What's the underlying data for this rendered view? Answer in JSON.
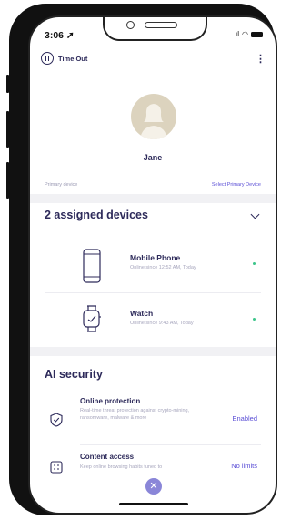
{
  "status_bar": {
    "time": "3:06"
  },
  "header": {
    "timeout_label": "Time Out",
    "more_icon": "more-vertical-icon"
  },
  "profile": {
    "name": "Jane",
    "primary_label": "Primary device",
    "select_primary_label": "Select Primary Device"
  },
  "devices_section": {
    "title": "2 assigned devices",
    "devices": [
      {
        "name": "Mobile Phone",
        "status": "Online since 12:52 AM, Today",
        "icon": "mobile-phone-icon"
      },
      {
        "name": "Watch",
        "status": "Online since 9:43 AM, Today",
        "icon": "watch-icon"
      }
    ]
  },
  "ai_security": {
    "title": "AI security",
    "features": [
      {
        "title": "Online protection",
        "description": "Real-time threat protection against crypto-mining, ransomware, malware & more",
        "status": "Enabled",
        "icon": "shield-check-icon"
      },
      {
        "title": "Content access",
        "description": "Keep online browsing habits tuned to",
        "status": "No limits",
        "icon": "content-filter-icon"
      }
    ]
  },
  "colors": {
    "accent": "#5b4fd6",
    "text": "#2d2a5a",
    "online": "#3cc58a",
    "fab": "#8a86d8"
  }
}
